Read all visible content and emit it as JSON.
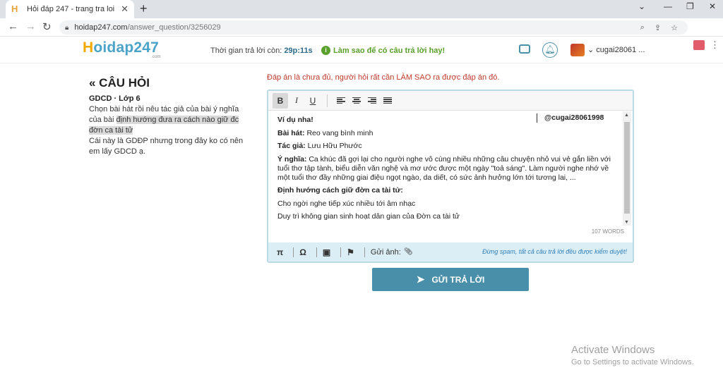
{
  "browser": {
    "tab_title": "Hỏi đáp 247 - trang tra loi",
    "tab_favicon": "H",
    "new_tab": "+",
    "url_host": "hoidap247.com",
    "url_path": "/answer_question/3256029"
  },
  "header": {
    "logo_h": "H",
    "logo_rest": "oidap247",
    "logo_suffix": ".com",
    "timer_label": "Thời gian trả lời còn:",
    "timer_value": "29p:11s",
    "hint": "Làm sao để có câu trả lời hay!",
    "username": "cugai28061 ..."
  },
  "question": {
    "heading": "« CÂU HỎI",
    "subject": "GDCD · Lớp 6",
    "text_1": "Chọn bài hát rồi nêu tác giả của bài ý nghĩa của bài",
    "text_highlight": "định hướng đưa ra cách nào giữ đc đờn ca tài tử",
    "text_2": "Cái này là GDĐP nhưng trong đây ko có nên em lấy GDCD ạ."
  },
  "editor": {
    "notice": "Đáp án là chưa đủ, người hỏi rất cần LÀM SAO ra được đáp án đó.",
    "toolbar": {
      "bold": "B",
      "italic": "I",
      "underline": "U"
    },
    "mention": "@cugai28061998",
    "line1": "Ví dụ nha!",
    "song_label": "Bài hát:",
    "song_value": "Reo vang bình minh",
    "author_label": "Tác giả:",
    "author_value": "Lưu Hữu Phước",
    "meaning_label": "Ý nghĩa:",
    "meaning_value": "Ca khúc đã gợi lại cho người nghe vô cùng nhiều những câu chuyện nhỏ vui vẻ gắn liền với tuổi thơ tập tành, biểu diễn văn nghệ và mơ ước được một ngày \"toả sáng\". Làm người nghe nhớ về một tuổi thơ đầy những giai điệu ngọt ngào, da diết, có sức ảnh hưởng lớn tới tương lai, ...",
    "direction_label": "Định hướng cách giữ đờn ca tài tử:",
    "direction_1": "Cho ngời nghe tiếp xúc nhiều tới âm nhạc",
    "direction_2": "Duy trì không gian sinh hoạt dân gian của Đờn ca tài tử",
    "word_count": "107 WORDS",
    "attach_label": "Gửi ảnh:",
    "spam_note": "Đừng spam, tất cả câu trả lời đều được kiểm duyệt!"
  },
  "submit_label": "GỬI TRẢ LỜI",
  "watermark": {
    "title": "Activate Windows",
    "subtitle": "Go to Settings to activate Windows."
  }
}
